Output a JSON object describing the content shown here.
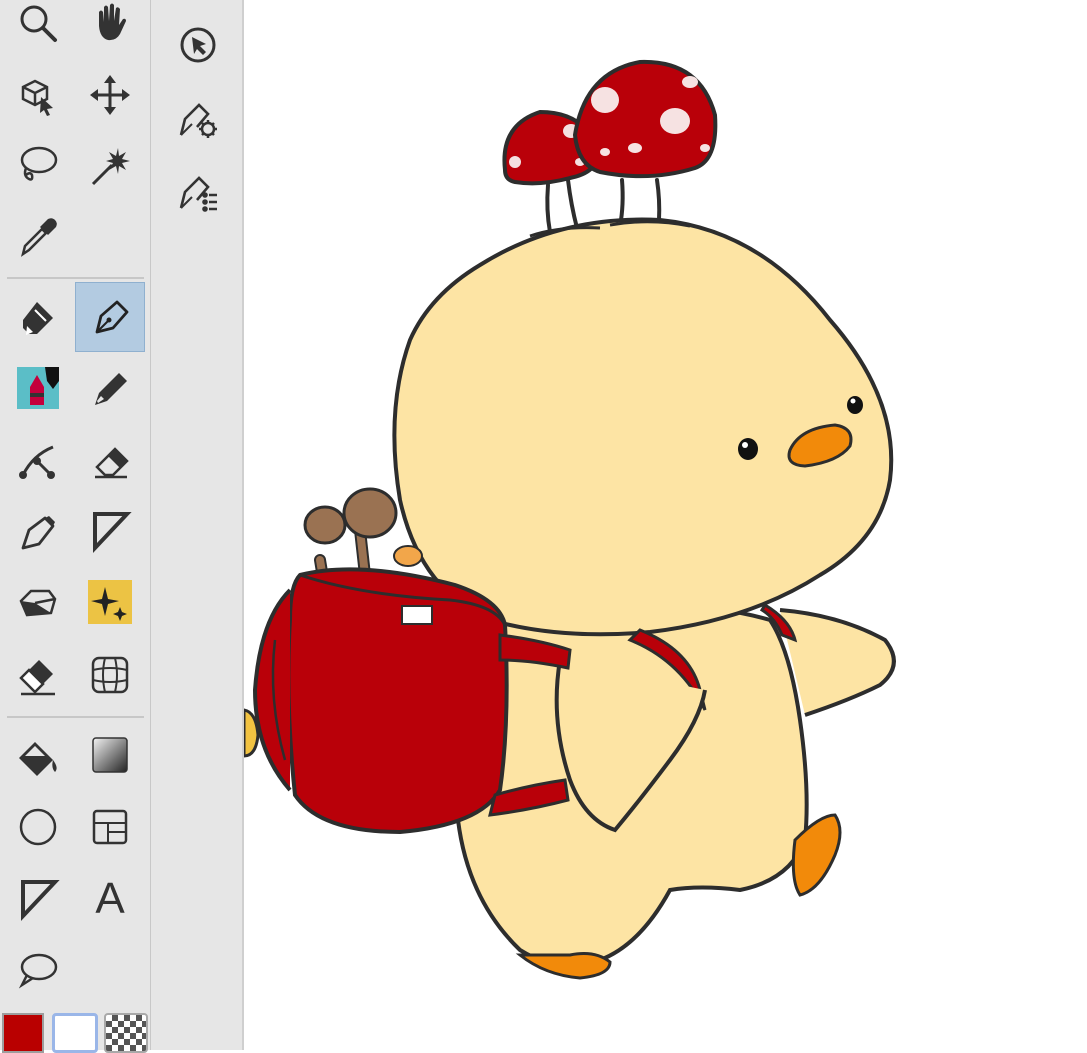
{
  "app": {
    "name": "drawing-app",
    "active_tool": "pen"
  },
  "toolbar": {
    "tools": [
      {
        "id": "zoom",
        "icon": "zoom-icon"
      },
      {
        "id": "hand",
        "icon": "hand-icon"
      },
      {
        "id": "object",
        "icon": "object-select-icon"
      },
      {
        "id": "move",
        "icon": "move-icon"
      },
      {
        "id": "lasso",
        "icon": "lasso-icon"
      },
      {
        "id": "magic-wand",
        "icon": "magic-wand-icon"
      },
      {
        "id": "eyedropper",
        "icon": "eyedropper-icon"
      },
      {
        "id": "marker",
        "icon": "marker-icon"
      },
      {
        "id": "pen",
        "icon": "pen-icon",
        "active": true
      },
      {
        "id": "decorative-brush",
        "icon": "decoration-brush-icon"
      },
      {
        "id": "pencil",
        "icon": "pencil-icon"
      },
      {
        "id": "vector-path",
        "icon": "vector-path-icon"
      },
      {
        "id": "eraser",
        "icon": "eraser-icon"
      },
      {
        "id": "fountain-pen",
        "icon": "fountain-pen-icon"
      },
      {
        "id": "ruler",
        "icon": "ruler-icon"
      },
      {
        "id": "blend",
        "icon": "blend-icon"
      },
      {
        "id": "sparkle-effect",
        "icon": "sparkle-icon"
      },
      {
        "id": "vector-eraser",
        "icon": "vector-eraser-icon"
      },
      {
        "id": "mesh-transform",
        "icon": "mesh-icon"
      },
      {
        "id": "fill",
        "icon": "fill-bucket-icon"
      },
      {
        "id": "gradient",
        "icon": "gradient-icon"
      },
      {
        "id": "figure",
        "icon": "circle-figure-icon"
      },
      {
        "id": "frame",
        "icon": "frame-icon"
      },
      {
        "id": "operation",
        "icon": "triangle-icon"
      },
      {
        "id": "text",
        "icon": "text-icon",
        "glyph": "A"
      },
      {
        "id": "balloon",
        "icon": "speech-balloon-icon"
      }
    ],
    "colors": {
      "main": "#b90000",
      "sub": "#ffffff",
      "transparent": "checker"
    }
  },
  "subtools": [
    {
      "id": "object-subtool",
      "icon": "object-cursor-icon"
    },
    {
      "id": "pen-settings",
      "icon": "pen-settings-icon"
    },
    {
      "id": "pen-layers",
      "icon": "pen-list-icon"
    }
  ],
  "canvas": {
    "content": "chick-with-mushroom-backpack-illustration"
  }
}
